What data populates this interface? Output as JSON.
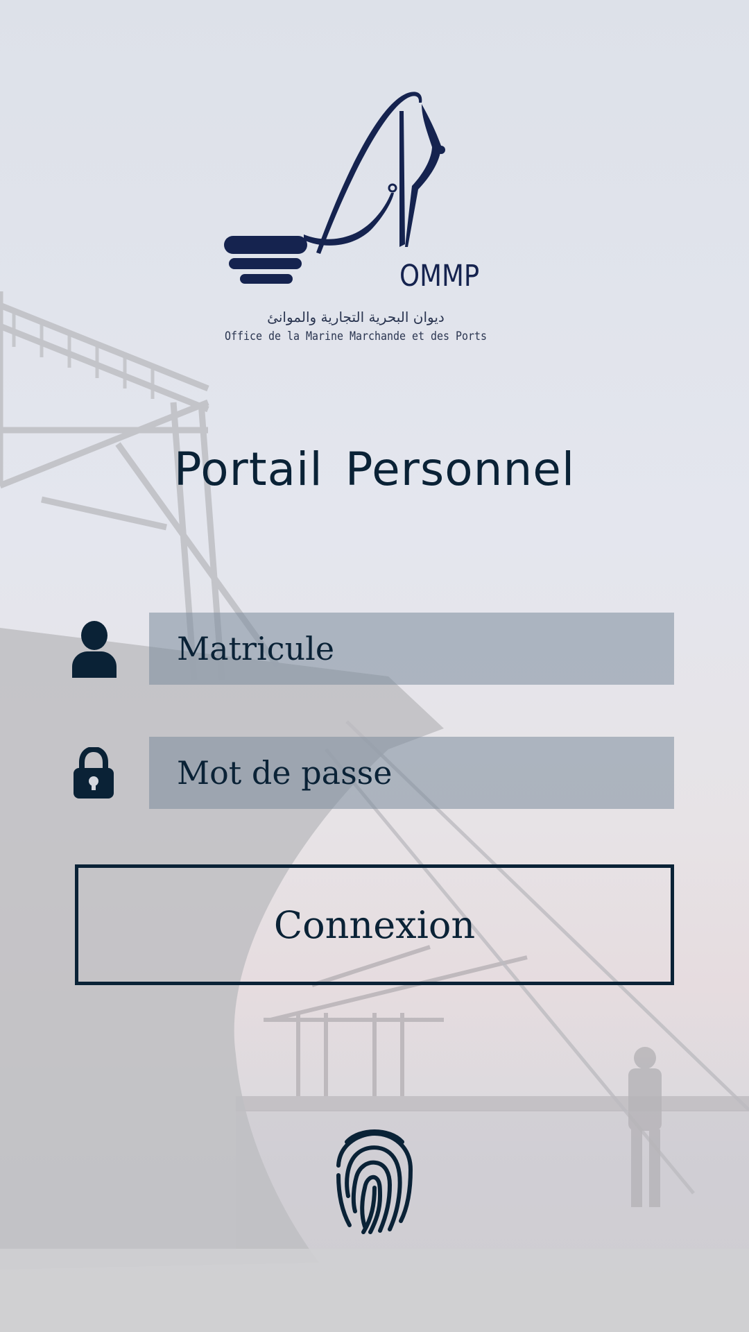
{
  "logo": {
    "acronym": "OMMP",
    "arabic_name": "ديوان البحرية التجارية والموانئ",
    "french_name": "Office de la Marine Marchande et des Ports"
  },
  "page_title": "Portail  Personnel",
  "login_form": {
    "username": {
      "placeholder": "Matricule",
      "value": "",
      "icon": "user-icon"
    },
    "password": {
      "placeholder": "Mot de passe",
      "value": "",
      "icon": "lock-icon"
    },
    "submit_label": "Connexion"
  },
  "biometric": {
    "icon": "fingerprint-icon"
  },
  "colors": {
    "primary": "#0a2236",
    "logo_navy": "#15234f",
    "field_bg": "#8c9cab"
  }
}
